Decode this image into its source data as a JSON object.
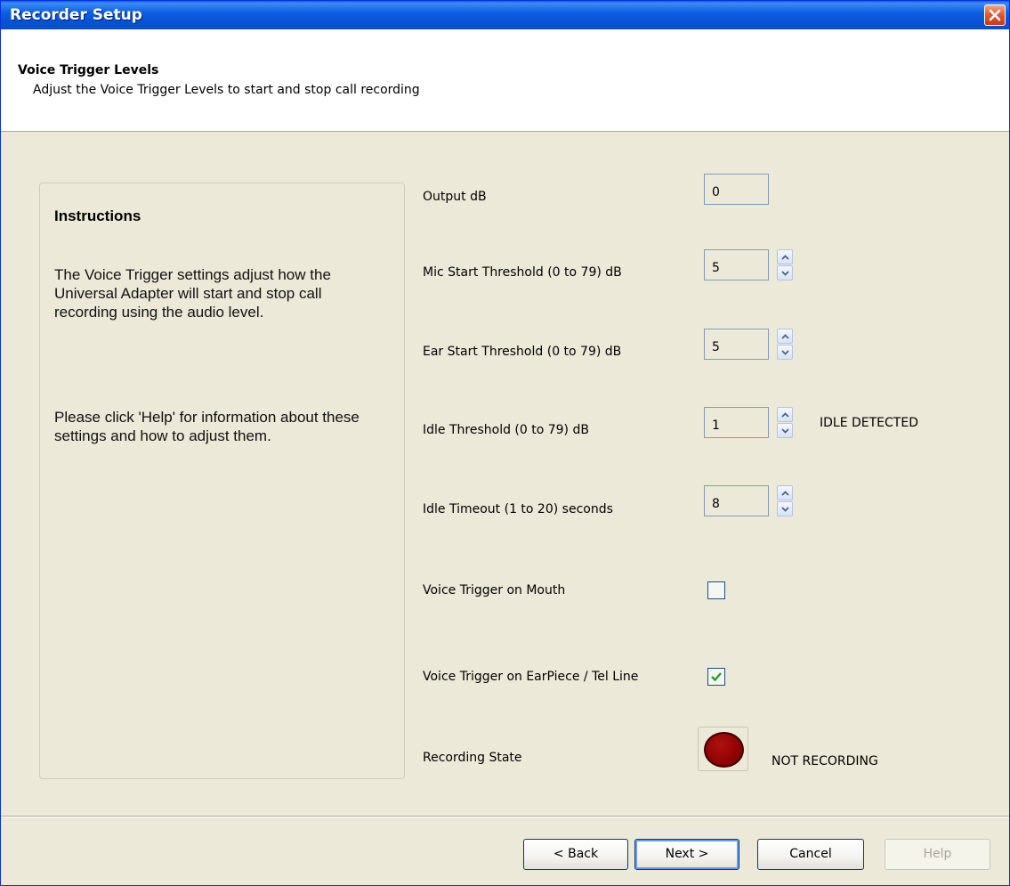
{
  "window": {
    "title": "Recorder Setup"
  },
  "header": {
    "title": "Voice Trigger Levels",
    "subtitle": "Adjust the Voice Trigger Levels to start and stop call recording"
  },
  "instructions": {
    "title": "Instructions",
    "paragraph1": "The Voice Trigger settings adjust how the Universal Adapter will start and stop call recording using the audio level.",
    "paragraph2": "Please click 'Help' for information about these settings and how to adjust them."
  },
  "settings": {
    "output_db": {
      "label": "Output dB",
      "value": "0"
    },
    "mic_start": {
      "label": "Mic Start Threshold (0 to 79) dB",
      "value": "5"
    },
    "ear_start": {
      "label": "Ear Start Threshold (0 to 79) dB",
      "value": "5"
    },
    "idle_threshold": {
      "label": "Idle Threshold (0 to 79) dB",
      "value": "1",
      "status": "IDLE DETECTED"
    },
    "idle_timeout": {
      "label": "Idle Timeout (1 to 20) seconds",
      "value": "8"
    },
    "trigger_mouth": {
      "label": "Voice Trigger on Mouth",
      "checked": false
    },
    "trigger_earpiece": {
      "label": "Voice Trigger on EarPiece / Tel Line",
      "checked": true
    },
    "recording_state": {
      "label": "Recording State",
      "status": "NOT RECORDING",
      "indicator_color": "#8a0000"
    }
  },
  "buttons": {
    "back": "< Back",
    "next": "Next >",
    "cancel": "Cancel",
    "help": "Help"
  },
  "icons": {
    "close": "close-icon",
    "spin_up": "chevron-up-icon",
    "spin_down": "chevron-down-icon",
    "check": "check-icon"
  }
}
